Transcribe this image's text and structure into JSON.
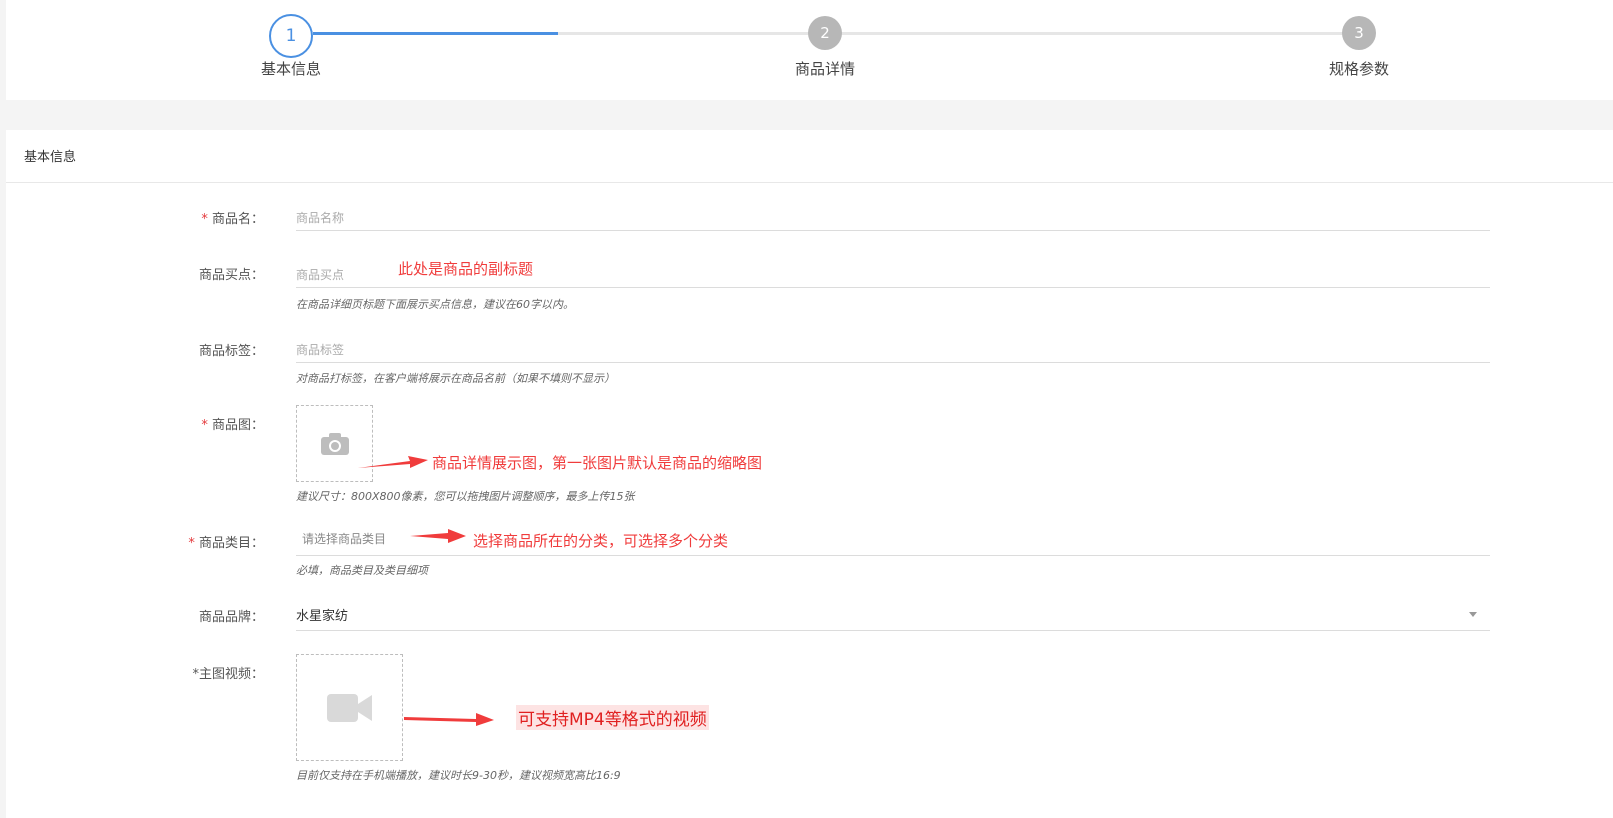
{
  "steps": [
    {
      "number": "1",
      "label": "基本信息"
    },
    {
      "number": "2",
      "label": "商品详情"
    },
    {
      "number": "3",
      "label": "规格参数"
    }
  ],
  "section_title": "基本信息",
  "fields": {
    "name": {
      "required_mark": "*",
      "label": "商品名：",
      "placeholder": "商品名称"
    },
    "selling_point": {
      "label": "商品买点：",
      "placeholder": "商品买点",
      "hint": "在商品详细页标题下面展示买点信息，建议在60字以内。"
    },
    "tags": {
      "label": "商品标签：",
      "placeholder": "商品标签",
      "hint": "对商品打标签，在客户端将展示在商品名前（如果不填则不显示）"
    },
    "image": {
      "required_mark": "*",
      "label": "商品图：",
      "hint": "建议尺寸：800X800像素，您可以拖拽图片调整顺序，最多上传15张",
      "icon": "camera-icon"
    },
    "category": {
      "required_mark": "*",
      "label": "商品类目：",
      "placeholder": "请选择商品类目",
      "hint": "必填，商品类目及类目细项"
    },
    "brand": {
      "label": "商品品牌：",
      "value": "水星家纺",
      "icon": "chevron-down-icon"
    },
    "video": {
      "label": "*主图视频：",
      "hint": "目前仅支持在手机端播放，建议时长9-30秒，建议视频宽高比16:9",
      "icon": "video-camera-icon"
    }
  },
  "annotations": {
    "selling_point": "此处是商品的副标题",
    "image": "商品详情展示图，第一张图片默认是商品的缩略图",
    "category": "选择商品所在的分类，可选择多个分类",
    "video": "可支持MP4等格式的视频"
  },
  "colors": {
    "accent": "#4a90e2",
    "inactive_step": "#b7b7b7",
    "required": "#e4393c",
    "annotation": "#f03c3c"
  },
  "progress": {
    "active_step": 1,
    "line_fill_fraction": 0.5
  }
}
